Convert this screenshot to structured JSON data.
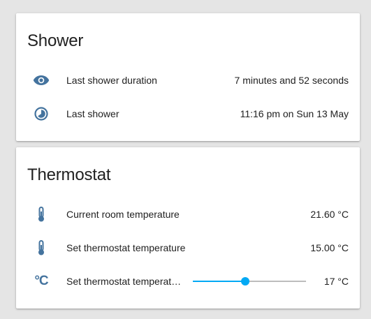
{
  "colors": {
    "icon": "#44739e",
    "accent": "#03a9f4",
    "card_bg": "#ffffff",
    "page_bg": "#e5e5e5"
  },
  "shower": {
    "title": "Shower",
    "rows": [
      {
        "icon": "eye-icon",
        "label": "Last shower duration",
        "value": "7 minutes and 52 seconds"
      },
      {
        "icon": "clock-pie-icon",
        "label": "Last shower",
        "value": "11:16 pm on Sun 13 May"
      }
    ]
  },
  "thermostat": {
    "title": "Thermostat",
    "rows": [
      {
        "icon": "thermometer-icon",
        "label": "Current room temperature",
        "value": "21.60 °C"
      },
      {
        "icon": "thermometer-icon",
        "label": "Set thermostat temperature",
        "value": "15.00 °C"
      }
    ],
    "slider_row": {
      "icon": "celsius-icon",
      "icon_glyph": "°C",
      "label": "Set thermostat temperat…",
      "value": "17 °C",
      "fraction": 0.46
    }
  }
}
